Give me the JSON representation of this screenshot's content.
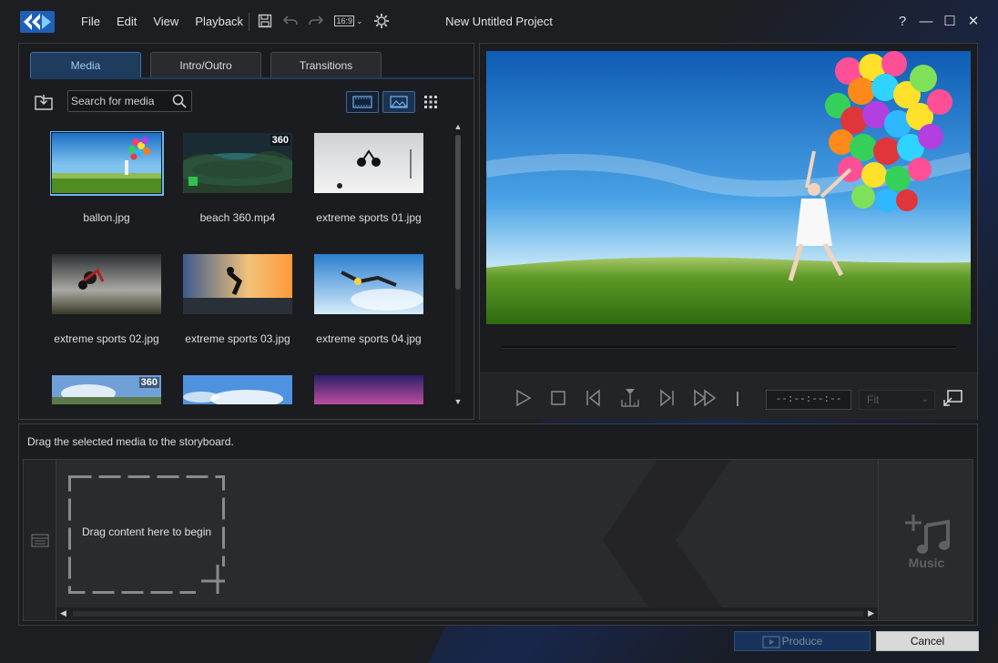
{
  "window": {
    "title": "New Untitled Project",
    "help": "?",
    "minimize": "—",
    "maximize": "☐",
    "close": "✕"
  },
  "menu": [
    "File",
    "Edit",
    "View",
    "Playback"
  ],
  "toolbar": {
    "icons": [
      "save-icon",
      "undo-icon",
      "redo-icon",
      "aspect-ratio-icon",
      "settings-icon"
    ],
    "aspect_ratio": "16:9"
  },
  "library": {
    "tabs": [
      "Media",
      "Intro/Outro",
      "Transitions"
    ],
    "active_tab": "Media",
    "search_placeholder": "Search for media",
    "items": [
      {
        "name": "ballon.jpg",
        "selected": true,
        "badge": ""
      },
      {
        "name": "beach 360.mp4",
        "selected": false,
        "badge": "360"
      },
      {
        "name": "extreme sports 01.jpg",
        "selected": false,
        "badge": ""
      },
      {
        "name": "extreme sports 02.jpg",
        "selected": false,
        "badge": ""
      },
      {
        "name": "extreme sports 03.jpg",
        "selected": false,
        "badge": ""
      },
      {
        "name": "extreme sports 04.jpg",
        "selected": false,
        "badge": ""
      },
      {
        "name": "",
        "selected": false,
        "badge": "360"
      },
      {
        "name": "",
        "selected": false,
        "badge": ""
      },
      {
        "name": "",
        "selected": false,
        "badge": ""
      }
    ]
  },
  "preview": {
    "timecode": "--:--:--:--",
    "zoom": "Fit"
  },
  "storyboard": {
    "hint": "Drag the selected media to the storyboard.",
    "dropzone_text": "Drag content here to begin",
    "music_label": "Music"
  },
  "footer": {
    "produce_label": "Produce",
    "cancel_label": "Cancel"
  }
}
